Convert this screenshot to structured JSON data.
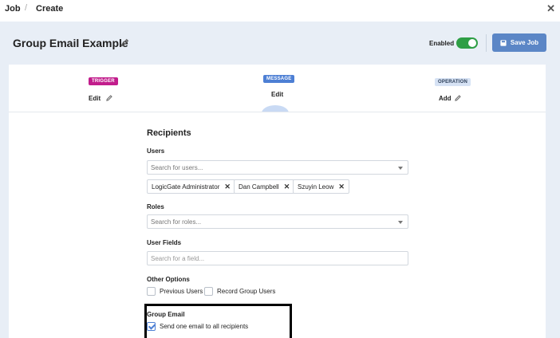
{
  "breadcrumb": {
    "root": "Job",
    "separator": "/",
    "current": "Create"
  },
  "page": {
    "title": "Group Email Example"
  },
  "header": {
    "enabled_label": "Enabled",
    "enabled": true,
    "save_label": "Save Job"
  },
  "steps": [
    {
      "badge": "TRIGGER",
      "action": "Edit"
    },
    {
      "badge": "MESSAGE",
      "action": "Edit"
    },
    {
      "badge": "OPERATION",
      "action": "Add"
    }
  ],
  "recipients": {
    "section_title": "Recipients",
    "users_label": "Users",
    "users_placeholder": "Search for users...",
    "selected_users": [
      "LogicGate Administrator",
      "Dan Campbell",
      "Szuyin Leow"
    ],
    "roles_label": "Roles",
    "roles_placeholder": "Search for roles...",
    "user_fields_label": "User Fields",
    "user_fields_placeholder": "Search for a field...",
    "other_options_label": "Other Options",
    "other_options": [
      {
        "label": "Previous Users",
        "checked": false
      },
      {
        "label": "Record Group Users",
        "checked": false
      }
    ],
    "group_email_label": "Group Email",
    "group_email_option": {
      "label": "Send one email to all recipients",
      "checked": true
    }
  },
  "colors": {
    "accent": "#5b86c6",
    "toggle_on": "#2e9e45",
    "trigger_badge": "#c21d8c",
    "message_badge": "#4d7fd4",
    "operation_badge": "#d6e2f4"
  }
}
